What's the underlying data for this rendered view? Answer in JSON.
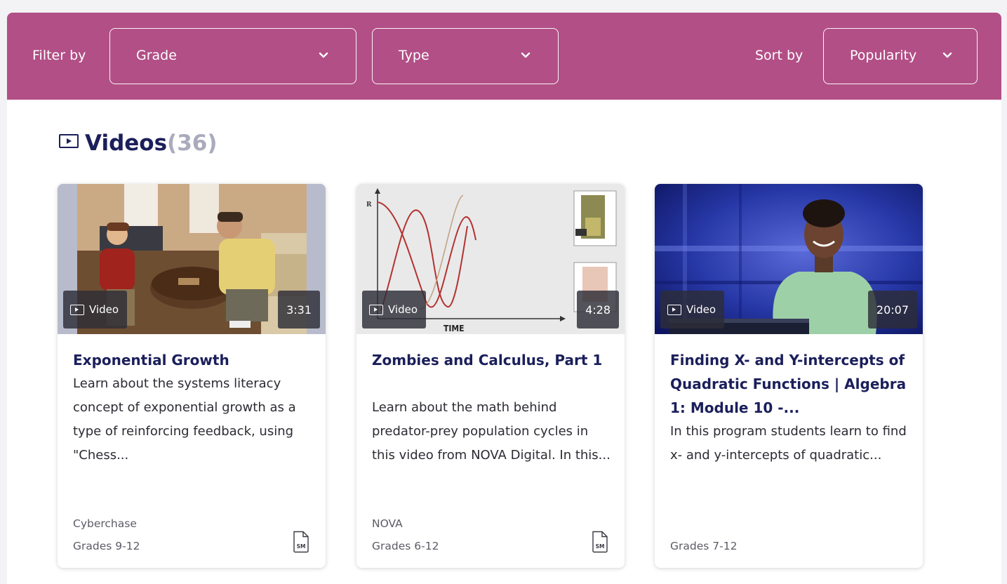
{
  "colors": {
    "filter_bar_bg": "#b24f86",
    "heading": "#1b1f5a",
    "count": "#a9abbd"
  },
  "filters": {
    "filter_label": "Filter by",
    "grade": {
      "label": "Grade",
      "icon": "chevron-down-icon"
    },
    "type": {
      "label": "Type",
      "icon": "chevron-down-icon"
    },
    "sort_label": "Sort by",
    "sort": {
      "label": "Popularity",
      "icon": "chevron-down-icon"
    }
  },
  "section": {
    "icon": "play-box-icon",
    "title": "Videos",
    "count": "(36)"
  },
  "cards": [
    {
      "badge": "Video",
      "duration": "3:31",
      "title": "Exponential Growth",
      "description": "Learn about the systems literacy concept of exponential growth as a type of reinforcing feedback, using \"Chess...",
      "source": "Cyberchase",
      "grades": "Grades 9-12",
      "icon": "sm-document-icon"
    },
    {
      "badge": "Video",
      "duration": "4:28",
      "title": "Zombies and Calculus, Part 1",
      "description": "Learn about the math behind predator-prey population cycles in this video from NOVA Digital. In this...",
      "source": "NOVA",
      "grades": "Grades 6-12",
      "icon": "sm-document-icon",
      "thumb_axis_label": "TIME",
      "thumb_y_label": "R"
    },
    {
      "badge": "Video",
      "duration": "20:07",
      "title": "Finding X- and Y-intercepts of Quadratic Functions | Algebra 1: Module 10 -...",
      "description": "In this program students learn to find x- and y-intercepts of quadratic...",
      "source": "",
      "grades": "Grades 7-12"
    }
  ]
}
